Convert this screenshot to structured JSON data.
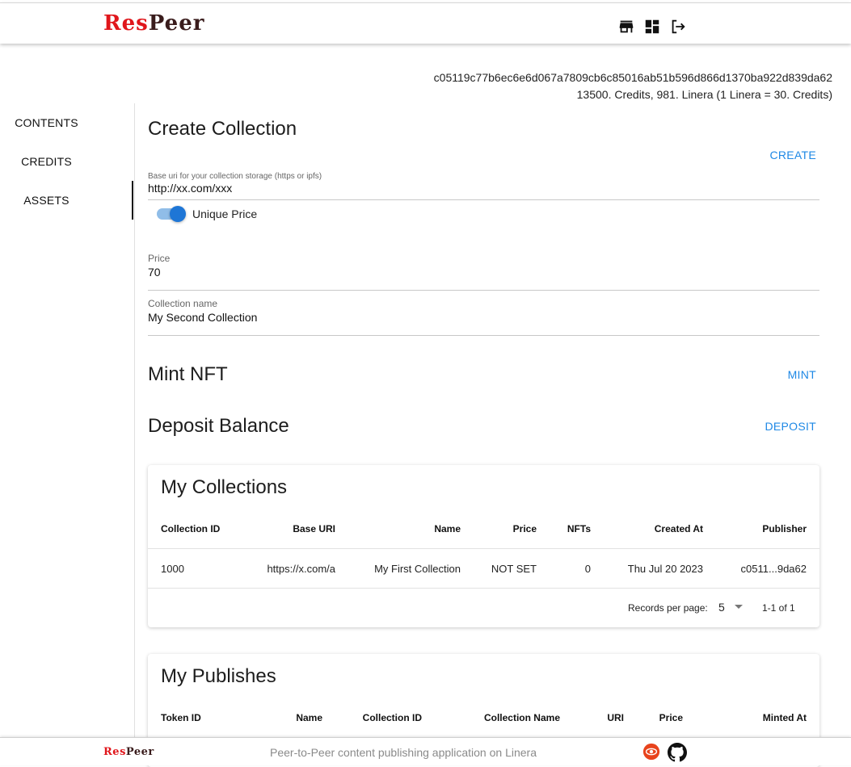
{
  "header": {
    "logo_red": "Res",
    "logo_dark": "Peer",
    "icons": [
      "store-icon",
      "dashboard-icon",
      "logout-icon"
    ]
  },
  "account": {
    "id": "c05119c77b6ec6e6d067a7809cb6c85016ab51b596d866d1370ba922d839da62",
    "balance": "13500. Credits, 981. Linera (1 Linera = 30. Credits)"
  },
  "sidebar": {
    "items": [
      {
        "label": "CONTENTS"
      },
      {
        "label": "CREDITS"
      },
      {
        "label": "ASSETS"
      }
    ],
    "active": "ASSETS"
  },
  "create_collection": {
    "title": "Create Collection",
    "action": "CREATE",
    "base_uri_label": "Base uri for your collection storage (https or ipfs)",
    "base_uri_value": "http://xx.com/xxx",
    "toggle_label": "Unique Price",
    "toggle_on": true,
    "price_label": "Price",
    "price_value": "70",
    "name_label": "Collection name",
    "name_value": "My Second Collection"
  },
  "mint": {
    "title": "Mint NFT",
    "action": "MINT"
  },
  "deposit": {
    "title": "Deposit Balance",
    "action": "DEPOSIT"
  },
  "my_collections": {
    "title": "My Collections",
    "columns": [
      "Collection ID",
      "Base URI",
      "Name",
      "Price",
      "NFTs",
      "Created At",
      "Publisher"
    ],
    "rows": [
      [
        "1000",
        "https://x.com/a",
        "My First Collection",
        "NOT SET",
        "0",
        "Thu Jul 20 2023",
        "c0511...9da62"
      ]
    ],
    "records_label": "Records per page:",
    "records_value": "5",
    "range": "1-1 of 1"
  },
  "my_publishes": {
    "title": "My Publishes",
    "columns": [
      "Token ID",
      "Name",
      "Collection ID",
      "Collection Name",
      "URI",
      "Price",
      "Minted At"
    ]
  },
  "footer": {
    "logo_red": "Res",
    "logo_dark": "Peer",
    "tagline": "Peer-to-Peer content publishing application on Linera",
    "icons": [
      "linera-icon",
      "github-icon"
    ]
  },
  "colors": {
    "accent": "#1e88e5",
    "logo_red": "#e0161b",
    "logo_dark": "#3a1c1c",
    "linera_red": "#e8431c"
  }
}
